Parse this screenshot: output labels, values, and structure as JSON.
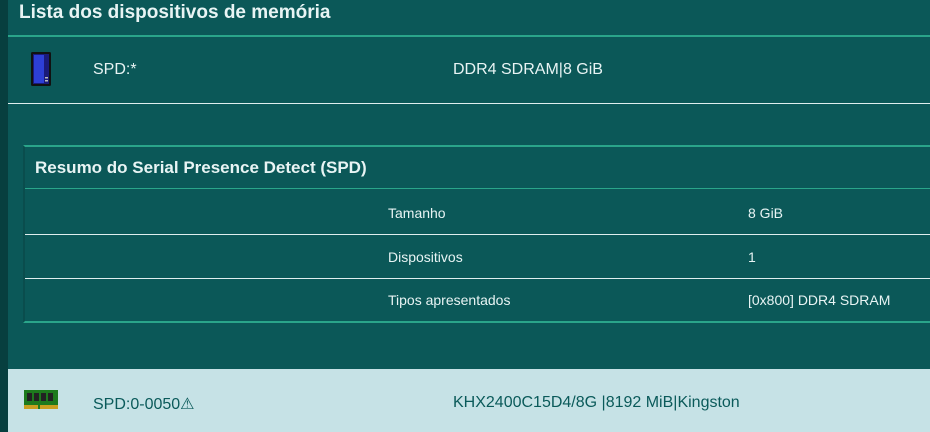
{
  "header": {
    "title": "Lista dos dispositivos de memória"
  },
  "device": {
    "icon": "computer-tower-icon",
    "name": "SPD:*",
    "description": "DDR4 SDRAM|8 GiB"
  },
  "spd_summary": {
    "title": "Resumo do Serial Presence Detect (SPD)",
    "rows": [
      {
        "key": "Tamanho",
        "value": "8 GiB"
      },
      {
        "key": "Dispositivos",
        "value": "1"
      },
      {
        "key": "Tipos apresentados",
        "value": "[0x800] DDR4 SDRAM"
      }
    ]
  },
  "module": {
    "icon": "ram-module-icon",
    "name": "SPD:0-0050⚠",
    "description": "KHX2400C15D4/8G |8192 MiB|Kingston"
  },
  "colors": {
    "background": "#0b5858",
    "accent_line": "#2aa58a",
    "selected_row": "#c6e2e6",
    "text_light": "#e8f4f4",
    "text_dark": "#0a5a5a"
  }
}
